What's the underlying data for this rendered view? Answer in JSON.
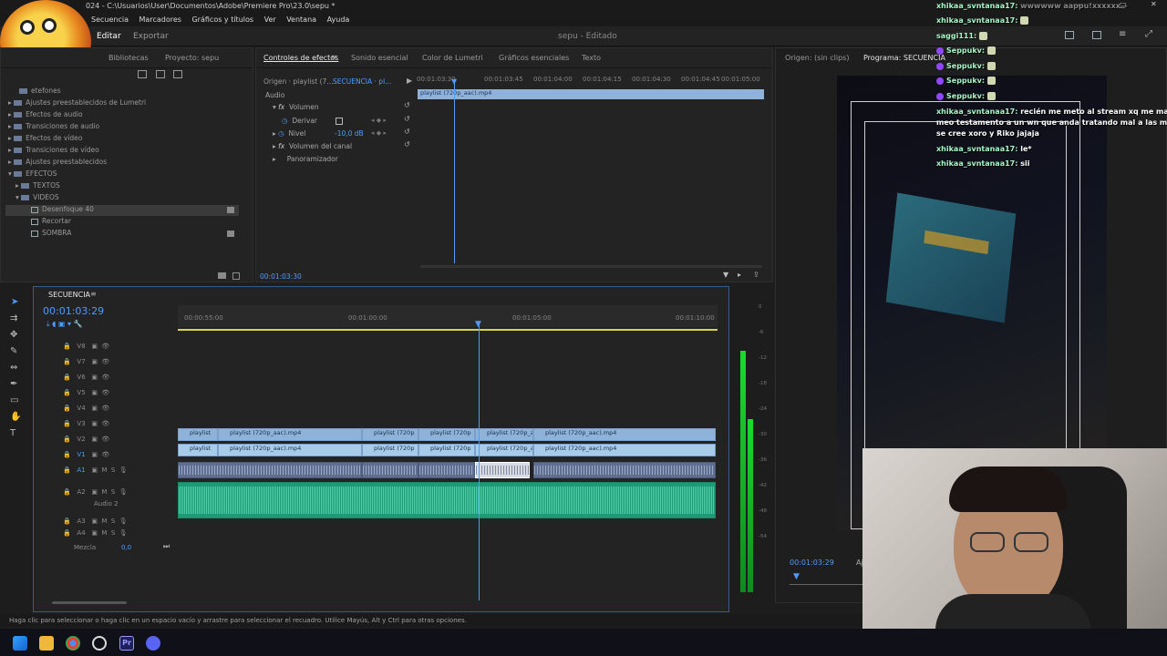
{
  "window": {
    "title": "024 - C:\\Usuarios\\User\\Documentos\\Adobe\\Premiere Pro\\23.0\\sepu *",
    "center_title": "sepu - Editado"
  },
  "menu": [
    "Secuencia",
    "Marcadores",
    "Gráficos y títulos",
    "Ver",
    "Ventana",
    "Ayuda"
  ],
  "workspaces": {
    "edit": "Editar",
    "export": "Exportar"
  },
  "project_panel": {
    "tabs": [
      "Bibliotecas",
      "Proyecto: sepu"
    ],
    "items": [
      {
        "label": "etefones",
        "kind": "folder"
      },
      {
        "label": "Ajustes preestablecidos de Lumetri",
        "kind": "folder"
      },
      {
        "label": "Efectos de audio",
        "kind": "folder"
      },
      {
        "label": "Transiciones de audio",
        "kind": "folder"
      },
      {
        "label": "Efectos de vídeo",
        "kind": "folder"
      },
      {
        "label": "Transiciones de vídeo",
        "kind": "folder"
      },
      {
        "label": "Ajustes preestablecidos",
        "kind": "folder"
      },
      {
        "label": "EFECTOS",
        "kind": "folder"
      },
      {
        "label": "TEXTOS",
        "kind": "folder"
      },
      {
        "label": "VIDEOS",
        "kind": "folder"
      },
      {
        "label": "Desenfoque 40",
        "kind": "fx"
      },
      {
        "label": "Recortar",
        "kind": "fx"
      },
      {
        "label": "SOMBRA",
        "kind": "fx"
      }
    ]
  },
  "effects_panel": {
    "tabs": [
      "Controles de efectos",
      "Sonido esencial",
      "Color de Lumetri",
      "Gráficos esenciales",
      "Texto"
    ],
    "source": "Origen · playlist (7...",
    "sequence": "SECUENCIA · pl...",
    "section": "Audio",
    "rows": [
      {
        "label": "Volumen",
        "value": ""
      },
      {
        "label": "Derivar",
        "value": ""
      },
      {
        "label": "Nivel",
        "value": "-10,0 dB"
      },
      {
        "label": "Volumen del canal",
        "value": ""
      },
      {
        "label": "Panoramizador",
        "value": ""
      }
    ],
    "clip_label": "playlist (720p_aac).mp4",
    "ruler": [
      "00:01:03:30",
      "00:01:03:45",
      "00:01:04:00",
      "00:01:04:15",
      "00:01:04:30",
      "00:01:04:45",
      "00:01:05:00"
    ],
    "timecode": "00:01:03:30"
  },
  "timeline": {
    "tab": "SECUENCIA",
    "timecode": "00:01:03:29",
    "ruler": [
      "00:00:55:00",
      "00:01:00:00",
      "00:01:05:00",
      "00:01:10:00"
    ],
    "video_tracks": [
      "V8",
      "V7",
      "V6",
      "V5",
      "V4",
      "V3",
      "V2",
      "V1"
    ],
    "audio_tracks": [
      "A1",
      "A2",
      "A3",
      "A4"
    ],
    "audio2_name": "Audio 2",
    "mix_label": "Mezcla",
    "mix_value": "0,0",
    "v2_clips": [
      "playlist",
      "playlist (720p_aac).mp4",
      "playlist (720p",
      "playlist (720p",
      "playlist (720p_a",
      "playlist (720p_aac).mp4"
    ],
    "v1_clips": [
      "playlist",
      "playlist (720p_aac).mp4",
      "playlist (720p",
      "playlist (720p",
      "playlist (720p_a",
      "playlist (720p_aac).mp4"
    ],
    "meter_scale": [
      "0",
      "-6",
      "-12",
      "-18",
      "-24",
      "-30",
      "-36",
      "-42",
      "-48",
      "-54"
    ]
  },
  "program_monitor": {
    "source_tab": "Origen: (sin clips)",
    "program_tab": "Programa: SECUENCIA",
    "timecode": "00:01:03:29",
    "fit": "Aj"
  },
  "chat": [
    {
      "user": "xhikaa_svntanaa17:",
      "text": "wwwwww aappu!xxxxxx—"
    },
    {
      "user": "xhikaa_svntanaa17:",
      "text": ""
    },
    {
      "user": "saggi111:",
      "text": ""
    },
    {
      "user": "Seppukv:",
      "text": ""
    },
    {
      "user": "Seppukv:",
      "text": ""
    },
    {
      "user": "Seppukv:",
      "text": ""
    },
    {
      "user": "Seppukv:",
      "text": ""
    },
    {
      "user": "xhikaa_svntanaa17:",
      "text": "recién me meto al stream xq me mandé"
    },
    {
      "user": "",
      "text": "meo testamento a un wn que anda tratando mal a las minas"
    },
    {
      "user": "",
      "text": "se cree xoro y Riko jajaja"
    },
    {
      "user": "xhikaa_svntanaa17:",
      "text": "le*"
    },
    {
      "user": "xhikaa_svntanaa17:",
      "text": "sii"
    }
  ],
  "status_bar": "Haga clic para seleccionar o haga clic en un espacio vacío y arrastre para seleccionar el recuadro. Utilice Mayús, Alt y Ctrl para otras opciones.",
  "colors": {
    "accent": "#4f9cff",
    "video_clip": "#8fb2d8",
    "audio_clip": "#5e6f92",
    "audio2_clip": "#1f9a76",
    "playhead": "#4f9cff"
  }
}
